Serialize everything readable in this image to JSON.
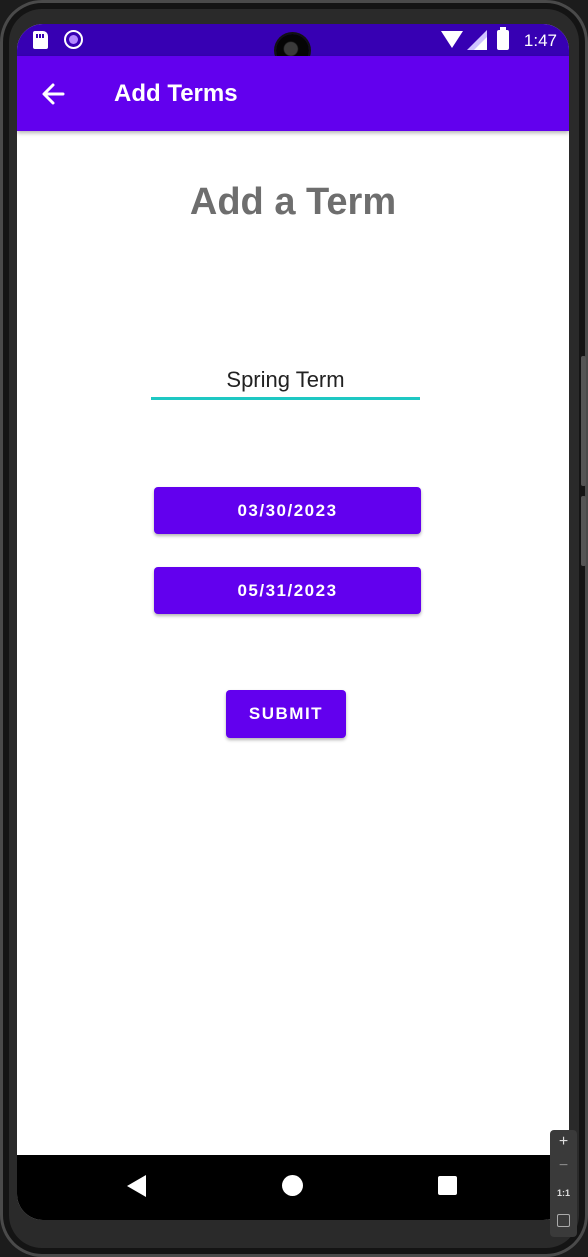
{
  "status_bar": {
    "time": "1:47",
    "icons": [
      "sd-card-icon",
      "record-icon",
      "wifi-icon",
      "signal-icon",
      "battery-icon"
    ]
  },
  "app_bar": {
    "title": "Add Terms",
    "back_icon": "arrow-left-icon",
    "background": "#6200ee"
  },
  "form": {
    "heading": "Add a Term",
    "term_name_value": "Spring Term",
    "start_date_label": "03/30/2023",
    "end_date_label": "05/31/2023",
    "submit_label": "SUBMIT"
  },
  "nav_bar": {
    "icons": [
      "nav-back-icon",
      "nav-home-icon",
      "nav-recents-icon"
    ]
  },
  "emulator_zoom": {
    "zoom_in": "+",
    "zoom_out": "−",
    "actual_size": "1:1"
  },
  "colors": {
    "status_bar": "#3700b3",
    "primary": "#6200ee",
    "accent_underline": "#1ec8c3",
    "heading_text": "#6e6e6e"
  }
}
